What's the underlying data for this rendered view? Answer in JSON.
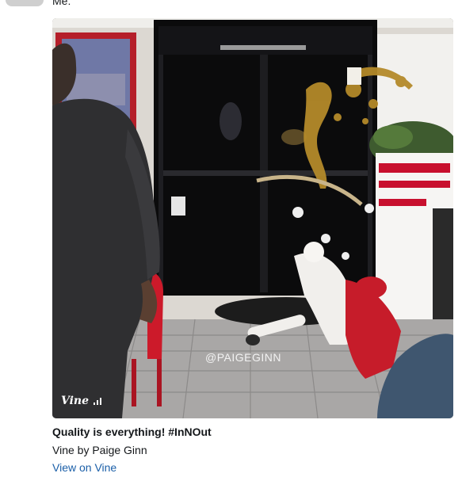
{
  "tweet": {
    "text": "Me:"
  },
  "media": {
    "watermark": "@PAIGEGINN",
    "badge_label": "Vine",
    "play_icon": "play-icon"
  },
  "card": {
    "title": "Quality is everything! #InNOut",
    "description": "Vine by Paige Ginn",
    "link_label": "View on Vine"
  },
  "colors": {
    "link": "#1b5fa8",
    "text": "#14171a",
    "sign_red": "#c8102e"
  }
}
